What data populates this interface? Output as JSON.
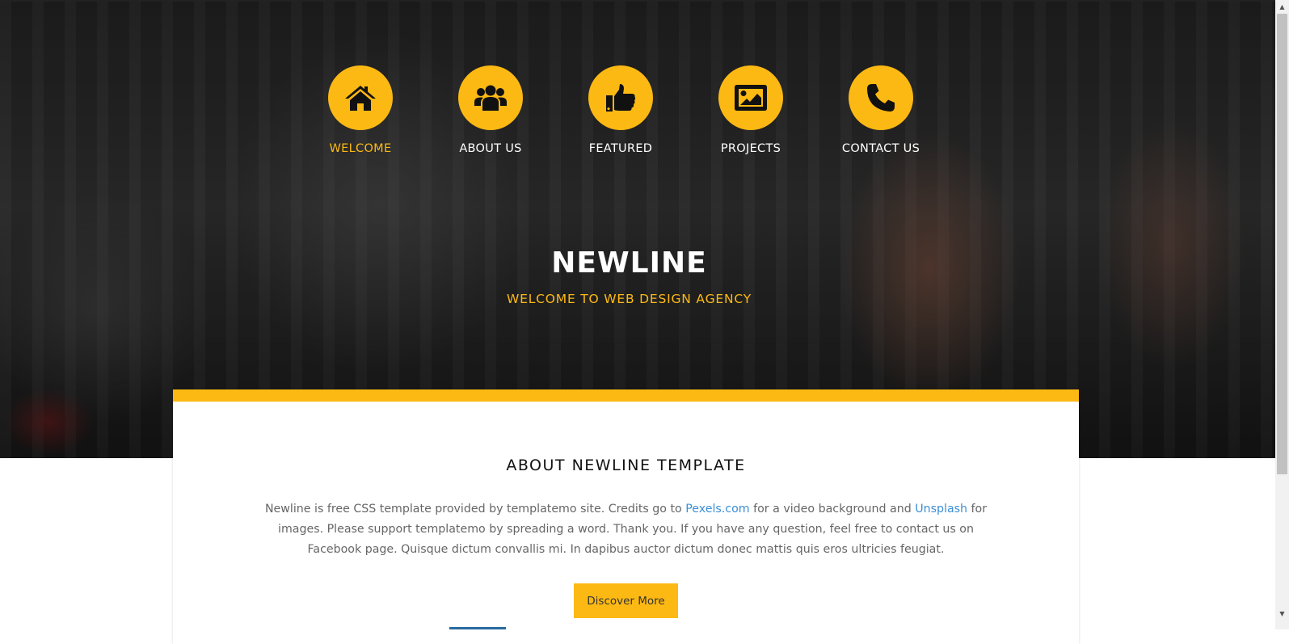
{
  "nav": {
    "items": [
      {
        "label": "WELCOME",
        "icon": "home-icon",
        "active": true
      },
      {
        "label": "ABOUT US",
        "icon": "users-icon",
        "active": false
      },
      {
        "label": "FEATURED",
        "icon": "thumbs-up-icon",
        "active": false
      },
      {
        "label": "PROJECTS",
        "icon": "image-icon",
        "active": false
      },
      {
        "label": "CONTACT US",
        "icon": "phone-icon",
        "active": false
      }
    ]
  },
  "hero": {
    "title": "NEWLINE",
    "subtitle": "WELCOME TO WEB DESIGN AGENCY"
  },
  "about": {
    "title": "ABOUT NEWLINE TEMPLATE",
    "text_1": "Newline is free CSS template provided by templatemo site. Credits go to ",
    "link_1": "Pexels.com",
    "text_2": " for a video background and ",
    "link_2": "Unsplash",
    "text_3": " for images. Please support templatemo by spreading a word. Thank you. If you have any question, feel free to contact us on Facebook page. Quisque dictum convallis mi. In dapibus auctor dictum donec mattis quis eros ultricies feugiat.",
    "button_label": "Discover More"
  },
  "colors": {
    "accent": "#fdb913",
    "link": "#3c8fd6",
    "body_text": "#666666"
  }
}
